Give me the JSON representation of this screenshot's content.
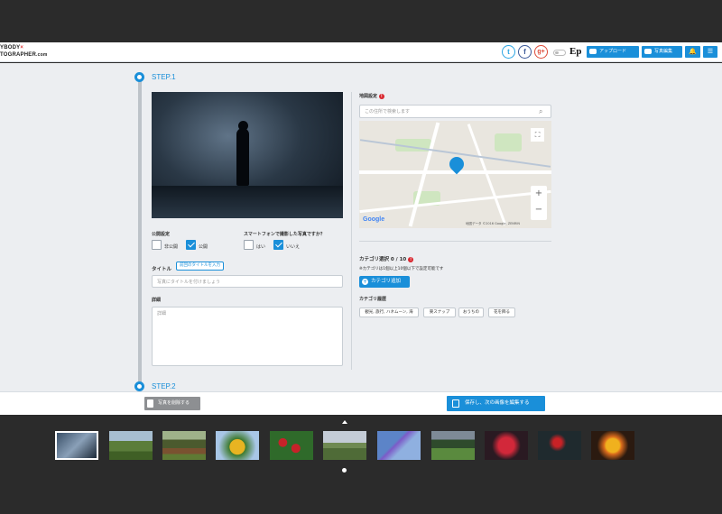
{
  "header": {
    "logo_line1": "YBODY",
    "logo_x": "×",
    "logo_line2": "TOGRAPHER",
    "logo_suffix": ".com",
    "twitter": "t",
    "facebook": "f",
    "gplus": "g+",
    "ep": "Ep",
    "upload_label": "アップロード",
    "photo_edit_label": "写真編集",
    "bell": "🔔",
    "menu": "☰"
  },
  "steps": {
    "step1": "STEP.1",
    "step2": "STEP.2"
  },
  "form": {
    "visibility_label": "公開設定",
    "private_label": "非公開",
    "public_label": "公開",
    "private_checked": false,
    "public_checked": true,
    "smartphone_label": "スマートフォンで撮影した写真ですか？",
    "yes_label": "はい",
    "no_label": "いいえ",
    "yes_checked": false,
    "no_checked": true,
    "title_label": "タイトル",
    "title_button": "前回のタイトルを入力",
    "title_placeholder": "写真にタイトルを付けましょう",
    "detail_label": "詳細",
    "detail_placeholder": "詳細"
  },
  "map": {
    "label": "地図設定",
    "search_placeholder": "この住所で検索します",
    "google": "Google",
    "attribution": "地図データ ©2016 Google, ZENRIN"
  },
  "category": {
    "select_label": "カテゴリ選択 0 / 10",
    "note": "※カテゴリは1個以上10個以下で設定可能です",
    "add_button": "カテゴリ追加",
    "history_label": "カテゴリ履歴",
    "tags": [
      "観光, 旅行, ハネムーン, 海",
      "東スナップ",
      "おうちの",
      "花を飾る"
    ]
  },
  "actions": {
    "delete_label": "写真を削除する",
    "save_label": "保存し、次の画像を編集する"
  },
  "filmstrip": {
    "thumbs": [
      "night-art",
      "field",
      "horse-race",
      "sunflower",
      "red-berries",
      "grass-landscape",
      "kite-sky",
      "stadium",
      "red-flower",
      "red-tulip-dark",
      "yellow-rose"
    ]
  },
  "colors": {
    "accent": "#1a8fd9",
    "dark_bg": "#2b2b2b",
    "main_bg": "#eceef1"
  }
}
